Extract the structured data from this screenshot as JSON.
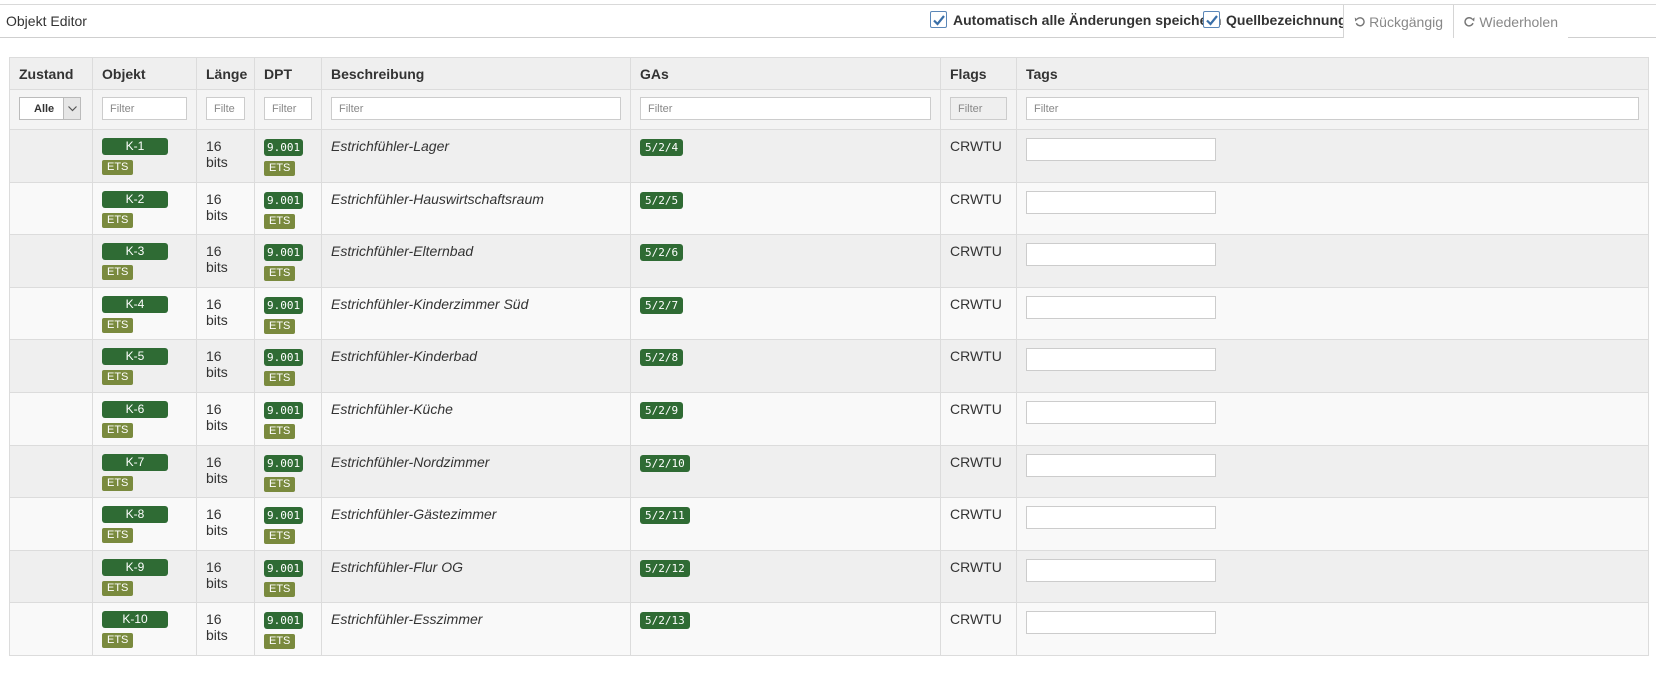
{
  "toolbar": {
    "title": "Objekt Editor",
    "autosave_label": "Automatisch alle Änderungen speichern",
    "autosave_checked": true,
    "source_label": "Quellbezeichnung",
    "source_checked": true,
    "undo_label": "Rückgängig",
    "redo_label": "Wiederholen"
  },
  "table": {
    "columns": [
      "Zustand",
      "Objekt",
      "Länge",
      "DPT",
      "Beschreibung",
      "GAs",
      "Flags",
      "Tags"
    ],
    "filters": {
      "state_selected": "Alle",
      "objekt_placeholder": "Filter",
      "laenge_placeholder": "Filte",
      "dpt_placeholder": "Filter",
      "beschreibung_placeholder": "Filter",
      "gas_placeholder": "Filter",
      "flags_placeholder": "Filter",
      "tags_placeholder": "Filter"
    },
    "rows": [
      {
        "objekt": "K-1",
        "source": "ETS",
        "laenge": "16 bits",
        "dpt": "9.001",
        "dpt_source": "ETS",
        "beschreibung": "Estrichfühler-Lager",
        "ga": "5/2/4",
        "flags": "CRWTU"
      },
      {
        "objekt": "K-2",
        "source": "ETS",
        "laenge": "16 bits",
        "dpt": "9.001",
        "dpt_source": "ETS",
        "beschreibung": "Estrichfühler-Hauswirtschaftsraum",
        "ga": "5/2/5",
        "flags": "CRWTU"
      },
      {
        "objekt": "K-3",
        "source": "ETS",
        "laenge": "16 bits",
        "dpt": "9.001",
        "dpt_source": "ETS",
        "beschreibung": "Estrichfühler-Elternbad",
        "ga": "5/2/6",
        "flags": "CRWTU"
      },
      {
        "objekt": "K-4",
        "source": "ETS",
        "laenge": "16 bits",
        "dpt": "9.001",
        "dpt_source": "ETS",
        "beschreibung": "Estrichfühler-Kinderzimmer Süd",
        "ga": "5/2/7",
        "flags": "CRWTU"
      },
      {
        "objekt": "K-5",
        "source": "ETS",
        "laenge": "16 bits",
        "dpt": "9.001",
        "dpt_source": "ETS",
        "beschreibung": "Estrichfühler-Kinderbad",
        "ga": "5/2/8",
        "flags": "CRWTU"
      },
      {
        "objekt": "K-6",
        "source": "ETS",
        "laenge": "16 bits",
        "dpt": "9.001",
        "dpt_source": "ETS",
        "beschreibung": "Estrichfühler-Küche",
        "ga": "5/2/9",
        "flags": "CRWTU"
      },
      {
        "objekt": "K-7",
        "source": "ETS",
        "laenge": "16 bits",
        "dpt": "9.001",
        "dpt_source": "ETS",
        "beschreibung": "Estrichfühler-Nordzimmer",
        "ga": "5/2/10",
        "flags": "CRWTU"
      },
      {
        "objekt": "K-8",
        "source": "ETS",
        "laenge": "16 bits",
        "dpt": "9.001",
        "dpt_source": "ETS",
        "beschreibung": "Estrichfühler-Gästezimmer",
        "ga": "5/2/11",
        "flags": "CRWTU"
      },
      {
        "objekt": "K-9",
        "source": "ETS",
        "laenge": "16 bits",
        "dpt": "9.001",
        "dpt_source": "ETS",
        "beschreibung": "Estrichfühler-Flur OG",
        "ga": "5/2/12",
        "flags": "CRWTU"
      },
      {
        "objekt": "K-10",
        "source": "ETS",
        "laenge": "16 bits",
        "dpt": "9.001",
        "dpt_source": "ETS",
        "beschreibung": "Estrichfühler-Esszimmer",
        "ga": "5/2/13",
        "flags": "CRWTU"
      }
    ]
  },
  "colors": {
    "badge_green": "#2f6b34",
    "badge_olive": "#7a8a3e",
    "header_bg": "#efefef",
    "checkbox_blue": "#5b87b8"
  },
  "icons": {
    "checkbox": "check-icon",
    "undo": "undo-icon",
    "redo": "redo-icon",
    "dropdown": "chevron-down-icon"
  }
}
